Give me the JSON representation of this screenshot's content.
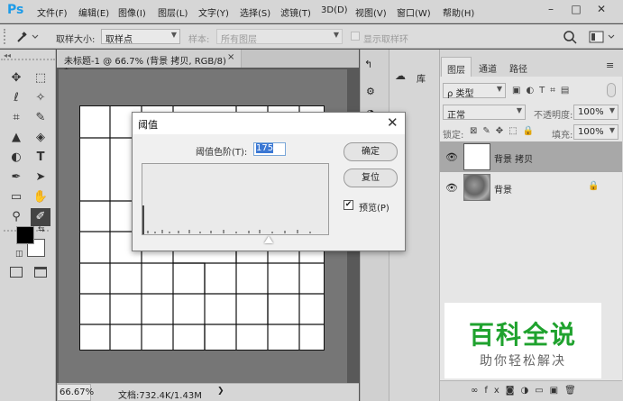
{
  "app": {
    "logo": "Ps"
  },
  "menu": [
    "文件(F)",
    "编辑(E)",
    "图像(I)",
    "图层(L)",
    "文字(Y)",
    "选择(S)",
    "滤镜(T)",
    "3D(D)",
    "视图(V)",
    "窗口(W)",
    "帮助(H)"
  ],
  "window_controls": {
    "minimize": "–",
    "maximize": "□",
    "close": "✕"
  },
  "options": {
    "sample_size_label": "取样大小:",
    "sample_size_value": "取样点",
    "sample_label": "样本:",
    "sample_value": "所有图层",
    "show_ring_label": "显示取样环"
  },
  "document": {
    "tab_title": "未标题-1 @ 66.7% (背景 拷贝, RGB/8) *",
    "close": "×",
    "zoom": "66.67%",
    "file_info": "文档:732.4K/1.43M"
  },
  "library": {
    "label": "库"
  },
  "layers_panel": {
    "tabs": [
      "图层",
      "通道",
      "路径"
    ],
    "filter_label": "ρ 类型",
    "blend_mode": "正常",
    "opacity_label": "不透明度:",
    "opacity_value": "100%",
    "lock_label": "锁定:",
    "fill_label": "填充:",
    "fill_value": "100%",
    "layers": [
      {
        "name": "背景 拷贝",
        "visible": true,
        "locked": false
      },
      {
        "name": "背景",
        "visible": true,
        "locked": true
      }
    ],
    "footer_icons": [
      "link-icon",
      "fx-icon",
      "mask-icon",
      "adjustment-icon",
      "folder-icon",
      "new-layer-icon",
      "trash-icon"
    ]
  },
  "dialog": {
    "title": "阈值",
    "close": "✕",
    "level_label": "阈值色阶(T):",
    "level_value": "175",
    "ok_label": "确定",
    "reset_label": "复位",
    "preview_label": "预览(P)",
    "preview_checked": true
  },
  "watermark": {
    "title": "百科全说",
    "subtitle": "助你轻松解决"
  },
  "colors": {
    "accent": "#1d9be8",
    "watermark_green": "#1fa22e",
    "selection": "#3b78d4"
  }
}
